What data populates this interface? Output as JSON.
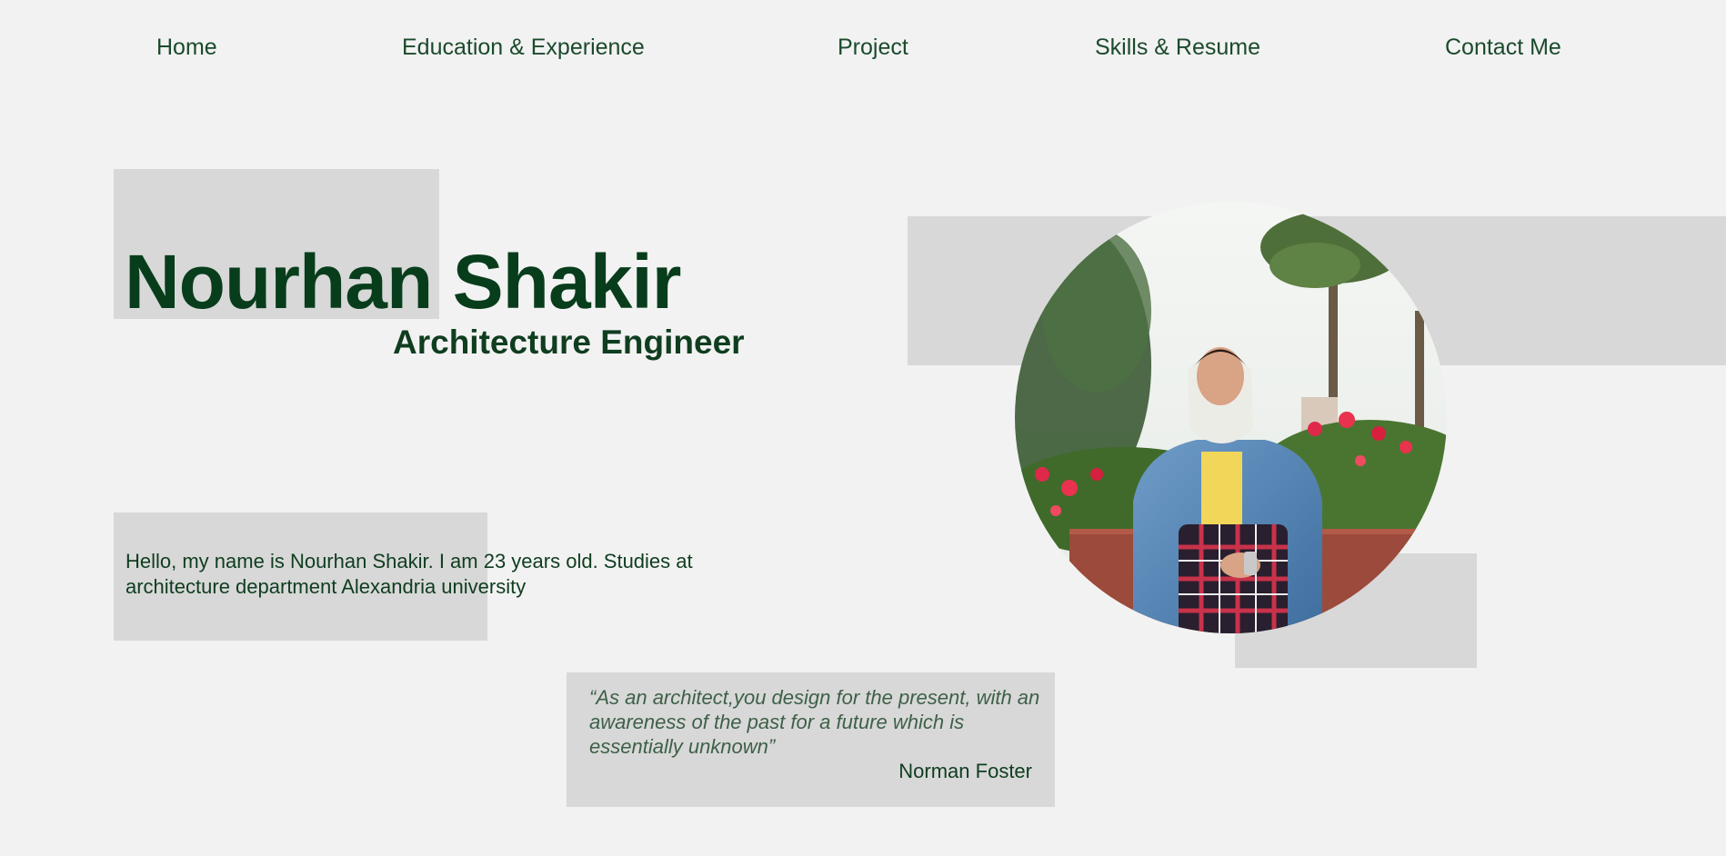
{
  "nav": {
    "home": "Home",
    "education": "Education & Experience",
    "project": "Project",
    "skills": "Skills & Resume",
    "contact": "Contact Me"
  },
  "hero": {
    "name": "Nourhan Shakir",
    "role": "Architecture Engineer"
  },
  "intro": {
    "text": "Hello, my name is Nourhan Shakir. I am 23 years old. Studies at architecture department Alexandria university"
  },
  "quote": {
    "text": "“As an architect,you design for the present, with an awareness of the past for a future which is essentially unknown”",
    "author": "Norman Foster"
  },
  "colors": {
    "background": "#f2f2f2",
    "block": "#d8d8d8",
    "primary_green": "#083d1c"
  }
}
